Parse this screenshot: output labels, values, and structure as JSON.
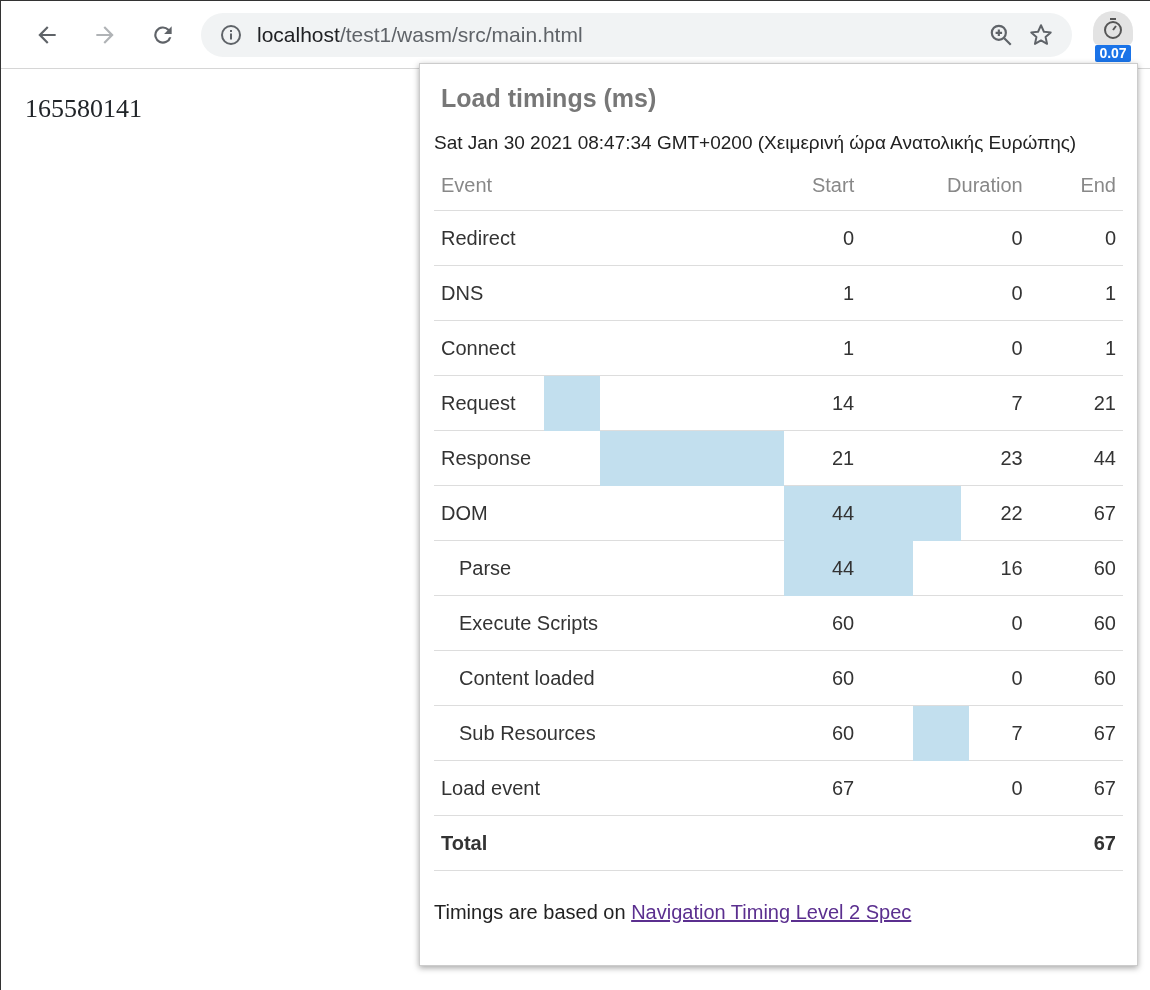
{
  "toolbar": {
    "url_host": "localhost",
    "url_path": "/test1/wasm/src/main.html",
    "extension_badge": "0.07"
  },
  "page": {
    "text": "165580141"
  },
  "popup": {
    "title": "Load timings (ms)",
    "date": "Sat Jan 30 2021 08:47:34 GMT+0200 (Χειμερινή ώρα Ανατολικής Ευρώπης)",
    "columns": [
      "Event",
      "Start",
      "Duration",
      "End"
    ],
    "rows": [
      {
        "event": "Redirect",
        "start": "0",
        "duration": "0",
        "end": "0"
      },
      {
        "event": "DNS",
        "start": "1",
        "duration": "0",
        "end": "1"
      },
      {
        "event": "Connect",
        "start": "1",
        "duration": "0",
        "end": "1"
      },
      {
        "event": "Request",
        "start": "14",
        "duration": "7",
        "end": "21"
      },
      {
        "event": "Response",
        "start": "21",
        "duration": "23",
        "end": "44"
      },
      {
        "event": "DOM",
        "start": "44",
        "duration": "22",
        "end": "67",
        "children": [
          {
            "event": "Parse",
            "start": "44",
            "duration": "16",
            "end": "60"
          },
          {
            "event": "Execute Scripts",
            "start": "60",
            "duration": "0",
            "end": "60"
          },
          {
            "event": "Content loaded",
            "start": "60",
            "duration": "0",
            "end": "60"
          },
          {
            "event": "Sub Resources",
            "start": "60",
            "duration": "7",
            "end": "67"
          }
        ]
      },
      {
        "event": "Load event",
        "start": "67",
        "duration": "0",
        "end": "67"
      }
    ],
    "total": {
      "label": "Total",
      "end": "67"
    },
    "footer": {
      "text": "Timings are based on ",
      "link": "Navigation Timing Level 2 Spec"
    }
  }
}
